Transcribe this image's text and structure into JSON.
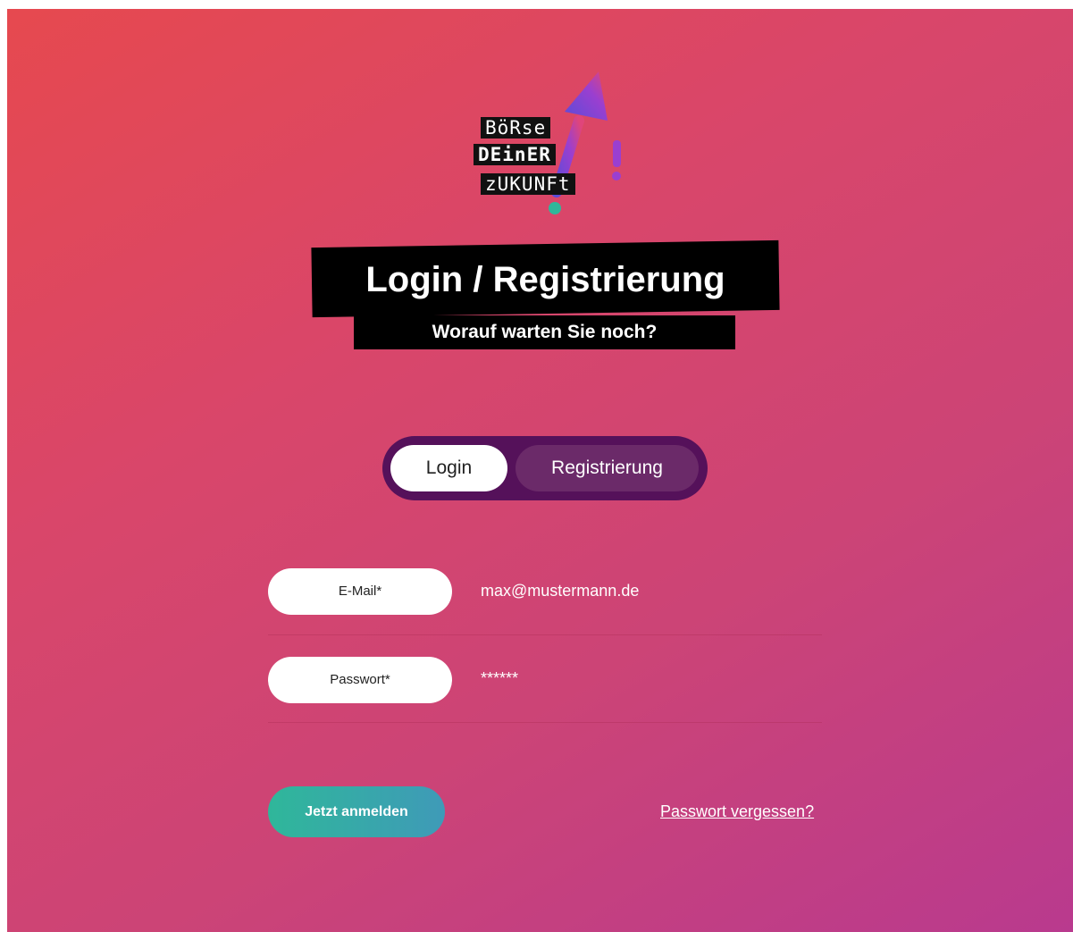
{
  "logo": {
    "line1": "BöRse",
    "line2": "DEinER",
    "line3": "zUKUNFt",
    "icon": "arrow-up-exclamation-logo-icon"
  },
  "header": {
    "title": "Login / Registrierung",
    "subtitle": "Worauf warten Sie noch?"
  },
  "tabs": {
    "login_label": "Login",
    "register_label": "Registrierung",
    "active": "Login"
  },
  "form": {
    "email": {
      "label": "E-Mail*",
      "value": "max@mustermann.de"
    },
    "password": {
      "label": "Passwort*",
      "value": "******"
    },
    "submit_label": "Jetzt anmelden",
    "forgot_label": "Passwort vergessen?"
  },
  "colors": {
    "gradient_start": "#e6494f",
    "gradient_end": "#b93a8e",
    "tab_background": "#55115a",
    "button_start": "#2fb79a",
    "button_end": "#3f9ab8"
  }
}
